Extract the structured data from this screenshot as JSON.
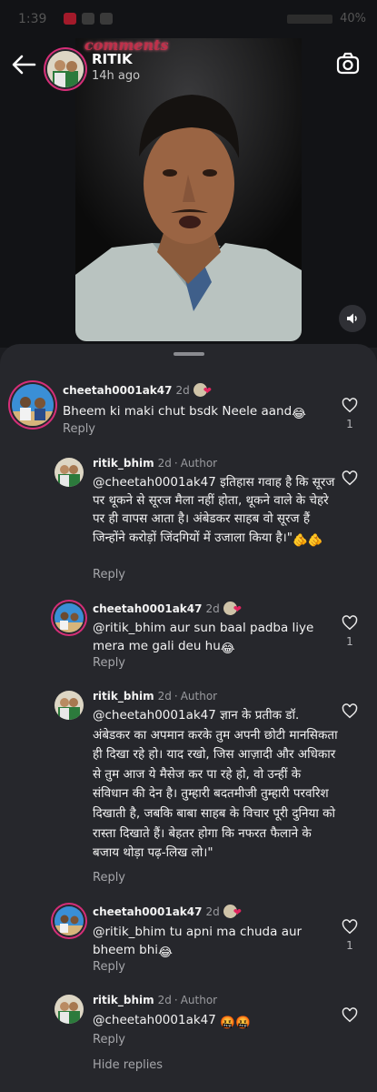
{
  "status_bar": {
    "time": "1:39",
    "battery": "40%"
  },
  "story": {
    "username": "RITIK",
    "time": "14h ago",
    "video_overlay_text": "comments"
  },
  "comments": [
    {
      "username": "cheetah0001ak47",
      "time": "2d",
      "text": "Bheem ki maki chut bsdk Neele aand",
      "emoji": "😂",
      "reply": "Reply",
      "likes": "1"
    },
    {
      "username": "ritik_bhim",
      "time": "2d",
      "author_tag": "Author",
      "text": "@cheetah0001ak47 इतिहास गवाह है कि सूरज पर थूकने से सूरज मैला नहीं होता, थूकने वाले के चेहरे पर ही वापस आता है। अंबेडकर साहब वो सूरज हैं जिन्होंने करोड़ों जिंदगियों में उजाला किया है।\"",
      "emoji": "🫵🫵",
      "reply": "Reply"
    },
    {
      "username": "cheetah0001ak47",
      "time": "2d",
      "text": "@ritik_bhim aur sun baal padba liye mera me gali deu hu",
      "emoji": "😂",
      "reply": "Reply",
      "likes": "1"
    },
    {
      "username": "ritik_bhim",
      "time": "2d",
      "author_tag": "Author",
      "text": "@cheetah0001ak47 ज्ञान के प्रतीक डॉ. अंबेडकर का अपमान करके तुम अपनी छोटी मानसिकता ही दिखा रहे हो। याद रखो, जिस आज़ादी और अधिकार से तुम आज ये मैसेज कर पा रहे हो, वो उन्हीं के संविधान की देन है। तुम्हारी बदतमीजी तुम्हारी परवरिश दिखाती है, जबकि बाबा साहब के विचार पूरी दुनिया को रास्ता दिखाते हैं। बेहतर होगा कि नफरत फैलाने के बजाय थोड़ा पढ़-लिख लो।\"",
      "emoji": "",
      "reply": "Reply"
    },
    {
      "username": "cheetah0001ak47",
      "time": "2d",
      "text": "@ritik_bhim tu apni ma chuda aur bheem bhi",
      "emoji": "😂",
      "reply": "Reply",
      "likes": "1"
    },
    {
      "username": "ritik_bhim",
      "time": "2d",
      "author_tag": "Author",
      "text": "@cheetah0001ak47 ",
      "emoji": "🤬🤬",
      "reply": "Reply"
    }
  ],
  "hide_replies": "Hide replies",
  "colors": {
    "background": "#26272c",
    "heart": "#e0245e",
    "ring": "#d62e78"
  },
  "icons": [
    "back-arrow-icon",
    "camera-icon",
    "speaker-icon",
    "heart-icon"
  ]
}
